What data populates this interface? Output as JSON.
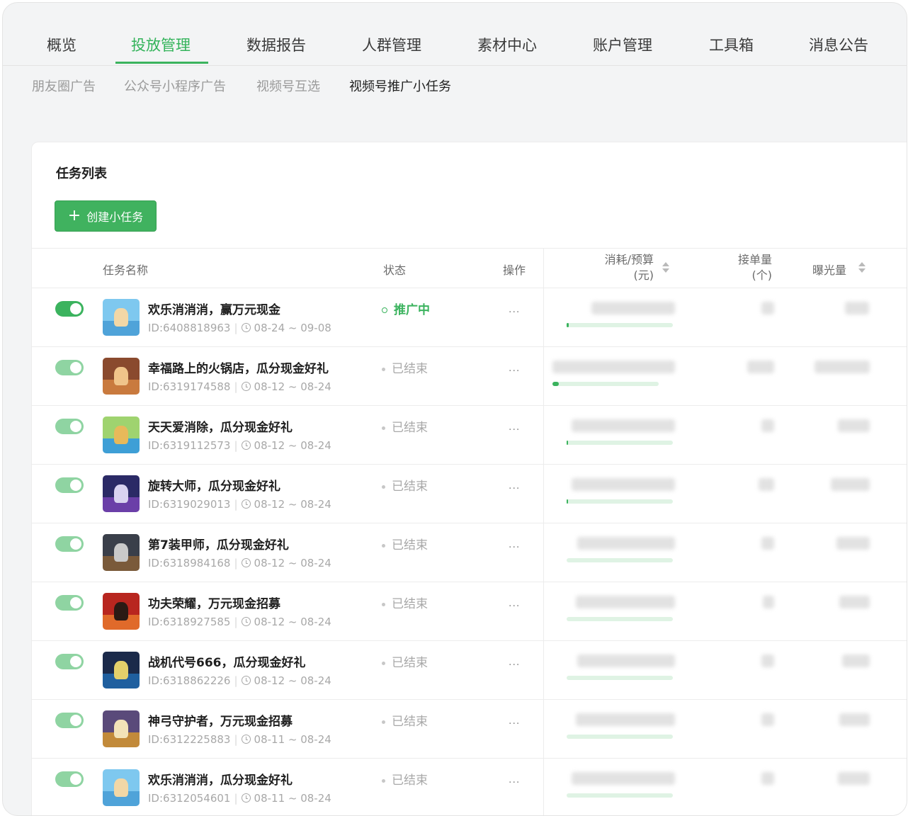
{
  "main_nav": {
    "tabs": [
      {
        "label": "概览",
        "active": false
      },
      {
        "label": "投放管理",
        "active": true
      },
      {
        "label": "数据报告",
        "active": false
      },
      {
        "label": "人群管理",
        "active": false
      },
      {
        "label": "素材中心",
        "active": false
      },
      {
        "label": "账户管理",
        "active": false
      },
      {
        "label": "工具箱",
        "active": false
      },
      {
        "label": "消息公告",
        "active": false
      }
    ]
  },
  "sub_nav": {
    "tabs": [
      {
        "label": "朋友圈广告",
        "active": false
      },
      {
        "label": "公众号小程序广告",
        "active": false
      },
      {
        "label": "视频号互选",
        "active": false
      },
      {
        "label": "视频号推广小任务",
        "active": true
      }
    ]
  },
  "task_list": {
    "title": "任务列表",
    "create_button": "创建小任务",
    "columns": {
      "name": "任务名称",
      "status": "状态",
      "action": "操作",
      "spend_line1": "消耗/预算",
      "spend_line2": "(元)",
      "orders_line1": "接单量",
      "orders_line2": "(个)",
      "impressions": "曝光量"
    },
    "more_label": "···",
    "rows": [
      {
        "name": "欢乐消消消，赢万元现金",
        "id": "ID:6408818963",
        "dates": "08-24 ~ 09-08",
        "status": "推广中",
        "enabled": true,
        "progress": 0.02
      },
      {
        "name": "幸福路上的火锅店，瓜分现金好礼",
        "id": "ID:6319174588",
        "dates": "08-12 ~ 08-24",
        "status": "已结束",
        "enabled": true,
        "progress": 0.06
      },
      {
        "name": "天天爱消除，瓜分现金好礼",
        "id": "ID:6319112573",
        "dates": "08-12 ~ 08-24",
        "status": "已结束",
        "enabled": true,
        "progress": 0.01
      },
      {
        "name": "旋转大师，瓜分现金好礼",
        "id": "ID:6319029013",
        "dates": "08-12 ~ 08-24",
        "status": "已结束",
        "enabled": true,
        "progress": 0.01
      },
      {
        "name": "第7装甲师，瓜分现金好礼",
        "id": "ID:6318984168",
        "dates": "08-12 ~ 08-24",
        "status": "已结束",
        "enabled": true,
        "progress": 0.0
      },
      {
        "name": "功夫荣耀，万元现金招募",
        "id": "ID:6318927585",
        "dates": "08-12 ~ 08-24",
        "status": "已结束",
        "enabled": true,
        "progress": 0.0
      },
      {
        "name": "战机代号666，瓜分现金好礼",
        "id": "ID:6318862226",
        "dates": "08-12 ~ 08-24",
        "status": "已结束",
        "enabled": true,
        "progress": 0.0
      },
      {
        "name": "神弓守护者，万元现金招募",
        "id": "ID:6312225883",
        "dates": "08-11 ~ 08-24",
        "status": "已结束",
        "enabled": true,
        "progress": 0.0
      },
      {
        "name": "欢乐消消消，瓜分现金好礼",
        "id": "ID:6312054601",
        "dates": "08-11 ~ 08-24",
        "status": "已结束",
        "enabled": true,
        "progress": 0.0
      }
    ]
  },
  "colors": {
    "accent": "#3bb35e",
    "toggle_on": "#3bb35e",
    "toggle_dim": "#8fd4a2",
    "progress_track": "#dff3e4"
  }
}
